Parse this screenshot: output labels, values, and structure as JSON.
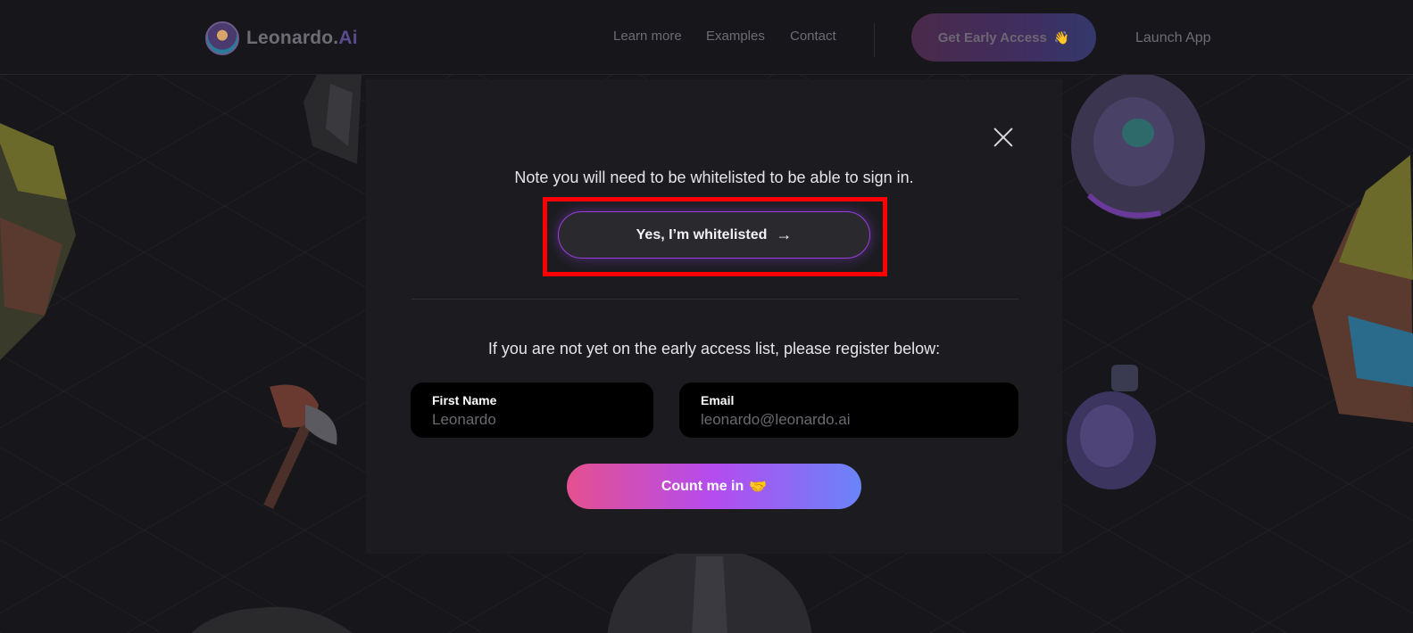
{
  "header": {
    "logo_text": "Leonardo",
    "logo_dot": ".",
    "logo_ai": "Ai",
    "nav": [
      "Learn more",
      "Examples",
      "Contact"
    ],
    "cta_label": "Get Early Access",
    "cta_emoji": "👋",
    "launch_label": "Launch App"
  },
  "modal": {
    "note": "Note you will need to be whitelisted to be able to sign in.",
    "whitelisted_button": "Yes, I’m whitelisted",
    "whitelisted_arrow": "→",
    "register_text": "If you are not yet on the early access list, please register below:",
    "first_name": {
      "label": "First Name",
      "value": "",
      "placeholder": "Leonardo"
    },
    "email": {
      "label": "Email",
      "value": "",
      "placeholder": "leonardo@leonardo.ai"
    },
    "submit_label": "Count me in",
    "submit_emoji": "🤝"
  },
  "colors": {
    "background": "#17161b",
    "modal": "#1c1c20",
    "highlight": "#ff0000",
    "button_border": "#9a3ee0",
    "gradient_start": "#e4508f",
    "gradient_mid": "#b44cf0",
    "gradient_end": "#6a84f8"
  }
}
